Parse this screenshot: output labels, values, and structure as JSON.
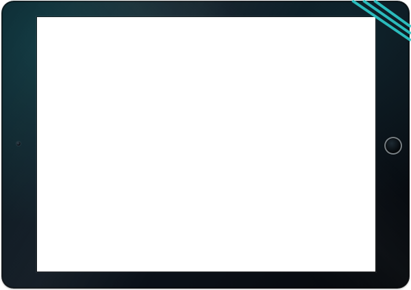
{
  "device": {
    "type": "tablet",
    "orientation": "landscape",
    "screen_content": "",
    "colors": {
      "bezel_dark": "#05080b",
      "bezel_teal_glow": "#20787d",
      "accent_stripe": "#2ec9c9",
      "screen": "#ffffff"
    }
  },
  "icons": {
    "home_button": "home-button-icon",
    "camera": "camera-icon"
  }
}
